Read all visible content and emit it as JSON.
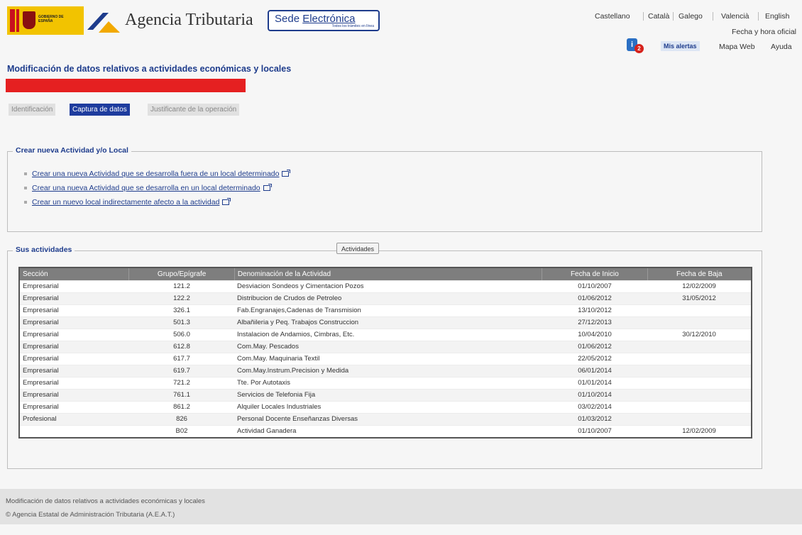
{
  "header": {
    "brand": "Agencia Tributaria",
    "sede_title_prefix": "Sede ",
    "sede_title_link": "Electrónica",
    "sede_tagline": "Todos los trámites en línea",
    "logo_text": "GOBIERNO DE ESPAÑA",
    "languages": [
      "Castellano",
      "Català",
      "Galego",
      "Valencià",
      "English"
    ],
    "fecha_hora": "Fecha y hora oficial",
    "mis_alertas": "Mis alertas",
    "alert_count": "2",
    "mapa_web": "Mapa Web",
    "ayuda": "Ayuda"
  },
  "page": {
    "title": "Modificación de datos relativos a actividades económicas y locales",
    "steps": [
      "Identificación",
      "Captura de datos",
      "Justificante de la operación"
    ],
    "active_step": 1
  },
  "crear": {
    "legend": "Crear nueva Actividad y/o Local",
    "links": [
      "Crear una nueva Actividad que se desarrolla fuera de un local determinado",
      "Crear una nueva Actividad que se desarrolla en un local determinado",
      "Crear un nuevo local indirectamente afecto a la actividad"
    ]
  },
  "actividades": {
    "legend": "Sus actividades",
    "button": "Actividades",
    "columns": [
      "Sección",
      "Grupo/Epígrafe",
      "Denominación de la Actividad",
      "Fecha de Inicio",
      "Fecha de Baja"
    ],
    "rows": [
      [
        "Empresarial",
        "121.2",
        "Desviacion Sondeos y Cimentacion Pozos",
        "01/10/2007",
        "12/02/2009"
      ],
      [
        "Empresarial",
        "122.2",
        "Distribucion de Crudos de Petroleo",
        "01/06/2012",
        "31/05/2012"
      ],
      [
        "Empresarial",
        "326.1",
        "Fab.Engranajes,Cadenas de Transmision",
        "13/10/2012",
        ""
      ],
      [
        "Empresarial",
        "501.3",
        "Albañileria y Peq. Trabajos Construccion",
        "27/12/2013",
        ""
      ],
      [
        "Empresarial",
        "506.0",
        "Instalacion de Andamios, Cimbras, Etc.",
        "10/04/2010",
        "30/12/2010"
      ],
      [
        "Empresarial",
        "612.8",
        "Com.May. Pescados",
        "01/06/2012",
        ""
      ],
      [
        "Empresarial",
        "617.7",
        "Com.May. Maquinaria Textil",
        "22/05/2012",
        ""
      ],
      [
        "Empresarial",
        "619.7",
        "Com.May.Instrum.Precision y Medida",
        "06/01/2014",
        ""
      ],
      [
        "Empresarial",
        "721.2",
        "Tte. Por Autotaxis",
        "01/01/2014",
        ""
      ],
      [
        "Empresarial",
        "761.1",
        "Servicios de Telefonia Fija",
        "01/10/2014",
        ""
      ],
      [
        "Empresarial",
        "861.2",
        "Alquiler Locales Industriales",
        "03/02/2014",
        ""
      ],
      [
        "Profesional",
        "826",
        "Personal Docente Enseñanzas Diversas",
        "01/03/2012",
        ""
      ],
      [
        "",
        "B02",
        "Actividad Ganadera",
        "01/10/2007",
        "12/02/2009"
      ]
    ]
  },
  "footer": {
    "line1": "Modificación de datos relativos a actividades económicas y locales",
    "line2": "© Agencia Estatal de Administración Tributaria (A.E.A.T.)"
  },
  "colors": {
    "brand_blue": "#1e3c8c",
    "active_step": "#1e3c9e",
    "redaction": "#e52021",
    "logo_yellow": "#f2c300"
  }
}
